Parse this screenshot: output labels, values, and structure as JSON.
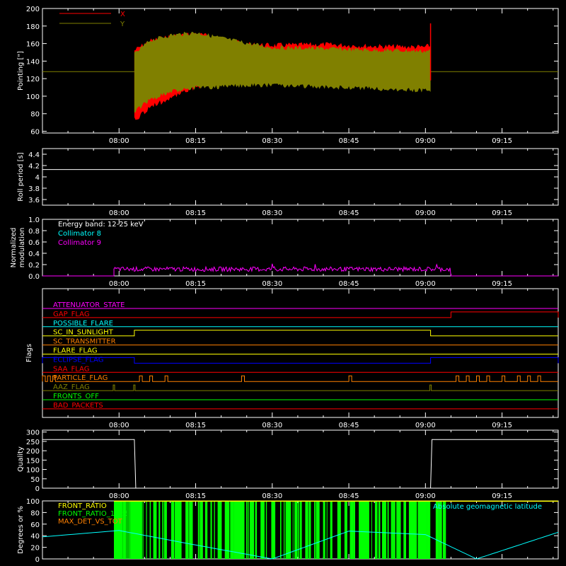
{
  "chart_data": [
    {
      "type": "line",
      "ylabel": "Pointing [\"]",
      "yticks": [
        60,
        80,
        100,
        120,
        140,
        160,
        180,
        200
      ],
      "ylim": [
        58,
        200
      ],
      "xticks": [
        "08:00",
        "08:15",
        "08:30",
        "08:45",
        "09:00",
        "09:15"
      ],
      "legend_placement": "top-left",
      "series": [
        {
          "name": "X",
          "color": "#ff0000"
        },
        {
          "name": "Y",
          "color": "#808000"
        }
      ],
      "baseline": 128,
      "x": [
        "08:03",
        "08:06",
        "08:10",
        "08:15",
        "08:20",
        "08:25",
        "08:30",
        "08:40",
        "08:50",
        "09:00",
        "09:01"
      ],
      "x_upper": [
        155,
        166,
        171,
        174,
        169,
        162,
        161,
        162,
        160,
        159,
        161
      ],
      "x_lower": [
        70,
        84,
        95,
        107,
        116,
        121,
        122,
        121,
        120,
        118,
        118
      ],
      "y_upper": [
        150,
        166,
        172,
        175,
        169,
        163,
        158,
        157,
        155,
        154,
        155
      ],
      "y_lower": [
        80,
        93,
        103,
        107,
        108,
        110,
        110,
        108,
        106,
        104,
        104
      ],
      "spike": {
        "x": "09:01",
        "value": 183
      }
    },
    {
      "type": "line",
      "ylabel": "Roll period [s]",
      "yticks": [
        3.6,
        3.8,
        4.0,
        4.2,
        4.4
      ],
      "ylim": [
        3.5,
        4.5
      ],
      "xticks": [
        "08:00",
        "08:15",
        "08:30",
        "08:45",
        "09:00",
        "09:15"
      ],
      "series": [
        {
          "color": "#ffffff",
          "value": 4.13
        }
      ]
    },
    {
      "type": "line",
      "ylabel": "Normalized modulation",
      "yticks": [
        "0.0",
        "0.2",
        "0.4",
        "0.6",
        "0.8",
        "1.0"
      ],
      "ylim": [
        0,
        1
      ],
      "xticks": [
        "08:00",
        "08:15",
        "08:30",
        "08:45",
        "09:00",
        "09:15"
      ],
      "annotation": "Energy band: 12-25 keV",
      "series": [
        {
          "name": "Collimator 8",
          "color": "#00ffff"
        },
        {
          "name": "Collimator 9",
          "color": "#ff00ff",
          "x_range": [
            "07:59",
            "09:05"
          ],
          "mean": 0.12,
          "noise": 0.04
        }
      ]
    },
    {
      "type": "line",
      "ylabel": "Flags",
      "xticks": [
        "08:00",
        "08:15",
        "08:30",
        "08:45",
        "09:00",
        "09:15"
      ],
      "series": [
        {
          "name": "ATTENUATOR_STATE",
          "color": "#ff00ff"
        },
        {
          "name": "GAP_FLAG",
          "color": "#ff0000",
          "high": [
            [
              "09:05",
              "09:26"
            ]
          ]
        },
        {
          "name": "POSSIBLE_FLARE",
          "color": "#00ffff"
        },
        {
          "name": "SC_IN_SUNLIGHT",
          "color": "#ffff00",
          "high": [
            [
              "08:03",
              "09:01"
            ]
          ]
        },
        {
          "name": "SC_TRANSMITTER",
          "color": "#ff8000"
        },
        {
          "name": "FLARE_FLAG",
          "color": "#ffff00"
        },
        {
          "name": "ECLIPSE_FLAG",
          "color": "#0000ff",
          "high": [
            [
              "07:45",
              "08:03"
            ],
            [
              "09:01",
              "09:26"
            ]
          ]
        },
        {
          "name": "SAA_FLAG",
          "color": "#ff0000"
        },
        {
          "name": "PARTICLE_FLAG",
          "color": "#ff8000",
          "pattern": "pulses"
        },
        {
          "name": "AAZ_FLAG",
          "color": "#808000",
          "pulses": [
            "07:59",
            "08:03",
            "09:01"
          ]
        },
        {
          "name": "FRONTS_OFF",
          "color": "#00ff00"
        },
        {
          "name": "BAD_PACKETS",
          "color": "#ff0000"
        }
      ]
    },
    {
      "type": "line",
      "ylabel": "Quality",
      "yticks": [
        0,
        50,
        100,
        150,
        200,
        250,
        300
      ],
      "ylim": [
        0,
        310
      ],
      "xticks": [
        "08:00",
        "08:15",
        "08:30",
        "08:45",
        "09:00",
        "09:15"
      ],
      "series": [
        {
          "color": "#ffffff",
          "high_value": 260,
          "low_range": [
            "08:03",
            "09:01"
          ]
        }
      ]
    },
    {
      "type": "area",
      "ylabel": "Degrees or %",
      "yticks": [
        0,
        20,
        40,
        60,
        80,
        100
      ],
      "ylim": [
        0,
        100
      ],
      "series": [
        {
          "name": "FRONT_RATIO",
          "color": "#ffff00"
        },
        {
          "name": "FRONT_RATIO_1225",
          "color": "#00ff00",
          "x_range": [
            "07:59",
            "09:05"
          ]
        },
        {
          "name": "MAX_DET_VS_TOT",
          "color": "#ff8000"
        },
        {
          "name": "Absolute geomagnetic latitude",
          "color": "#00ffff",
          "x": [
            "07:45",
            "08:00",
            "08:15",
            "08:30",
            "08:45",
            "09:00",
            "09:10",
            "09:26"
          ],
          "values": [
            38,
            49,
            24,
            0,
            48,
            42,
            0,
            46
          ]
        }
      ]
    }
  ]
}
